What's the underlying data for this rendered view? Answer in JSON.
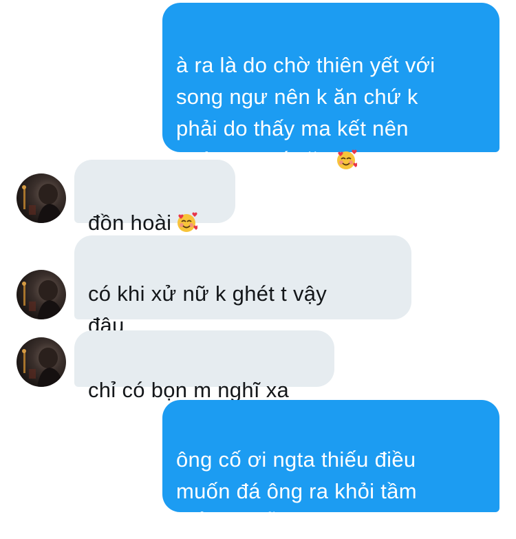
{
  "messages": [
    {
      "direction": "sent",
      "text": "à ra là do chờ thiên yết với\nsong ngư nên k ăn chứ k\nphải do thấy ma kết nên\nchán k muốn ăn",
      "emoji": "smiling-face-with-hearts"
    },
    {
      "direction": "received",
      "text": "đồn hoài",
      "emoji": "smiling-face-with-hearts"
    },
    {
      "direction": "received",
      "text": "có khi xử nữ k ghét t vậy\nđâu"
    },
    {
      "direction": "received",
      "text": "chỉ có bọn m nghĩ xa"
    },
    {
      "direction": "sent",
      "text": "ông cố ơi ngta thiếu điều\nmuốn đá ông ra khỏi tầm\nmắt mà vẫn lạc quan v ^^"
    }
  ],
  "colors": {
    "sent_bubble": "#1c9cf2",
    "received_bubble": "#e6ecf0",
    "sent_text": "#ffffff",
    "received_text": "#14171a"
  }
}
